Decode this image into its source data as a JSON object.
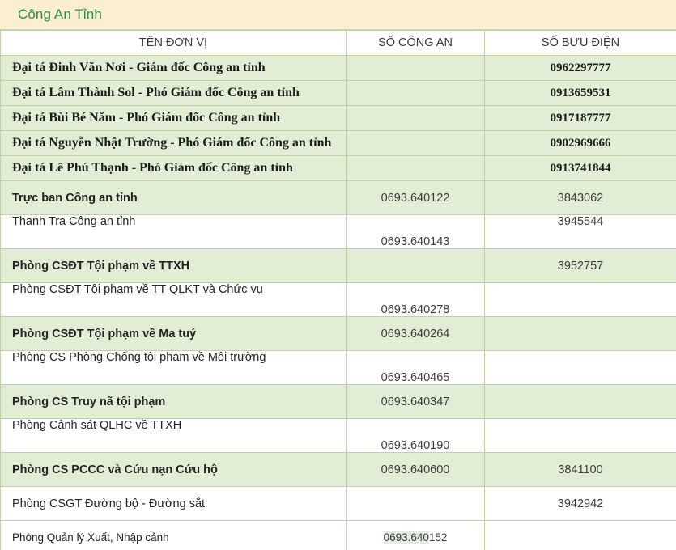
{
  "header": {
    "title": "Công An Tỉnh",
    "title_color": "#2e8b45",
    "bar_color": "#fcefd0"
  },
  "table": {
    "columns": [
      {
        "key": "name",
        "label": "TÊN ĐƠN VỊ"
      },
      {
        "key": "phone",
        "label": "SỐ CÔNG AN"
      },
      {
        "key": "post",
        "label": "SỐ BƯU ĐIỆN"
      }
    ],
    "row_colors": {
      "green": "#e2edd5",
      "white": "#ffffff",
      "border": "#bdd3a4"
    },
    "selection_highlight": "#e4ece0",
    "rows": [
      {
        "name": "Đại tá Đinh Văn Nơi - Giám đốc Công an tỉnh",
        "phone": "",
        "post": "0962297777",
        "style": "officer",
        "bg": "green"
      },
      {
        "name": "Đại tá Lâm Thành Sol - Phó Giám đốc Công an tỉnh",
        "phone": "",
        "post": "0913659531",
        "style": "officer",
        "bg": "green"
      },
      {
        "name": "Đại tá Bùi Bé Năm - Phó Giám đốc Công an tỉnh",
        "phone": "",
        "post": "0917187777",
        "style": "officer",
        "bg": "green"
      },
      {
        "name": "Đại tá Nguyễn Nhật Trường - Phó Giám đốc Công an tỉnh",
        "phone": "",
        "post": "0902969666",
        "style": "officer",
        "bg": "green"
      },
      {
        "name": "Đại tá Lê Phú Thạnh - Phó Giám đốc Công an tỉnh",
        "phone": "",
        "post": "0913741844",
        "style": "officer",
        "bg": "green"
      },
      {
        "name": "Trực ban Công an tỉnh",
        "phone": "0693.640122",
        "post": "3843062",
        "style": "unit",
        "bg": "green",
        "va_name": "mid",
        "va_phone": "mid",
        "va_post": "mid"
      },
      {
        "name": "Thanh Tra Công an tỉnh",
        "phone": "0693.640143",
        "post": "3945544",
        "style": "unit",
        "bg": "white",
        "va_name": "top",
        "va_phone": "bottom",
        "va_post": "top"
      },
      {
        "name": "Phòng CSĐT Tội phạm về TTXH",
        "phone": "",
        "post": "3952757",
        "style": "unit",
        "bg": "green",
        "va_name": "mid",
        "va_phone": "mid",
        "va_post": "mid"
      },
      {
        "name": "Phòng CSĐT Tội phạm về TT QLKT và Chức vụ",
        "phone": "0693.640278",
        "post": "",
        "style": "unit",
        "bg": "white",
        "va_name": "top",
        "va_phone": "bottom",
        "va_post": "mid"
      },
      {
        "name": "Phòng CSĐT Tội phạm về Ma tuý",
        "phone": "0693.640264",
        "post": "",
        "style": "unit",
        "bg": "green",
        "va_name": "mid",
        "va_phone": "mid",
        "va_post": "mid"
      },
      {
        "name": "Phòng CS Phòng Chống tội phạm về Môi trường",
        "phone": "0693.640465",
        "post": "",
        "style": "unit",
        "bg": "white",
        "va_name": "top",
        "va_phone": "bottom",
        "va_post": "mid"
      },
      {
        "name": "Phòng CS Truy nã tội phạm",
        "phone": "0693.640347",
        "post": "",
        "style": "unit",
        "bg": "green",
        "va_name": "mid",
        "va_phone": "mid",
        "va_post": "mid"
      },
      {
        "name": "Phòng Cảnh sát QLHC về TTXH",
        "phone": "0693.640190",
        "post": "",
        "style": "unit",
        "bg": "white",
        "va_name": "top",
        "va_phone": "bottom",
        "va_post": "mid"
      },
      {
        "name": "Phòng CS PCCC và Cứu nạn Cứu hộ",
        "phone": "0693.640600",
        "post": "3841100",
        "style": "unit",
        "bg": "green",
        "va_name": "mid",
        "va_phone": "mid",
        "va_post": "mid"
      },
      {
        "name": "Phòng CSGT Đường bộ - Đường sắt",
        "phone": "",
        "post": "3942942",
        "style": "unit",
        "bg": "white",
        "va_name": "mid",
        "va_phone": "mid",
        "va_post": "mid"
      },
      {
        "name": "Phòng Quản lý Xuất, Nhập cảnh",
        "phone": "0693.640152",
        "post": "",
        "style": "unit small",
        "bg": "white",
        "va_name": "mid",
        "va_phone": "mid",
        "va_post": "mid",
        "phone_selected_prefix": "0693.640",
        "phone_rest": "152"
      }
    ]
  }
}
